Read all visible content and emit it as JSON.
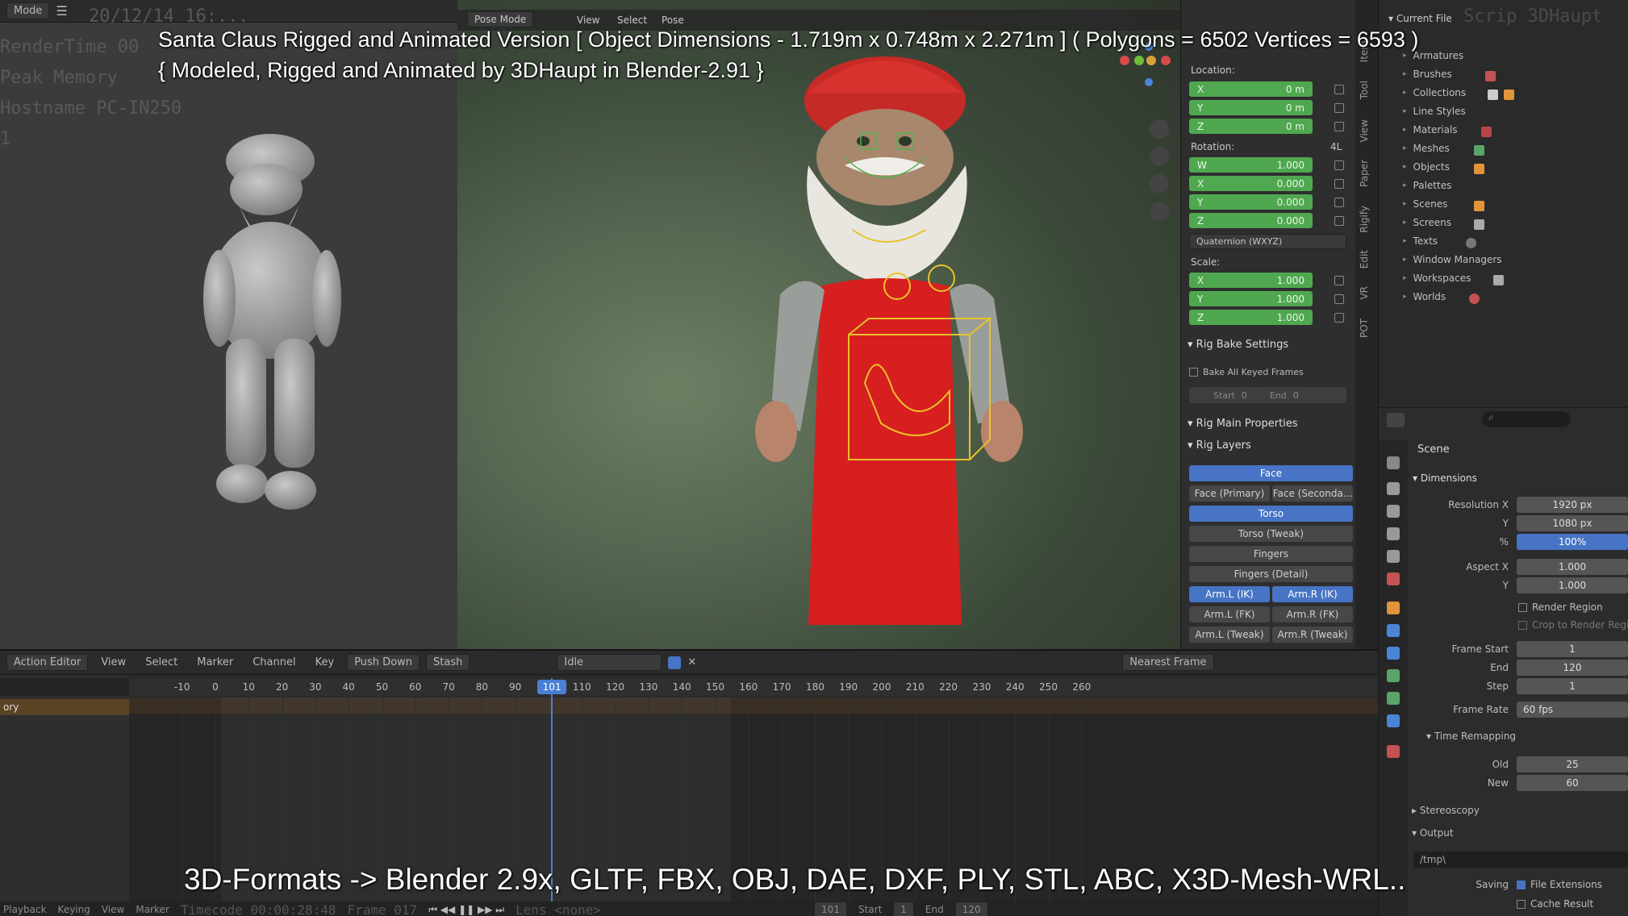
{
  "overlay": {
    "title_line1": "Santa Claus Rigged and Animated Version [ Object Dimensions -  1.719m x 0.748m x 2.271m ] ( Polygons = 6502  Vertices = 6593 )",
    "title_line2": "{ Modeled, Rigged and Animated by 3DHaupt in Blender-2.91 }",
    "formats": "3D-Formats -> Blender 2.9x, GLTF, FBX, OBJ, DAE, DXF, PLY, STL, ABC, X3D-Mesh-WRL.."
  },
  "left_panel": {
    "mode": "Mode",
    "sys_lines": [
      "20/12/14 16:...",
      "RenderTime 00",
      "Peak Memory",
      "Hostname PC-IN250",
      "1"
    ]
  },
  "viewport": {
    "mode": "Pose Mode",
    "menu": [
      "View",
      "Select",
      "Pose"
    ]
  },
  "npanel": {
    "location_label": "Location:",
    "location": [
      {
        "axis": "X",
        "value": "0 m"
      },
      {
        "axis": "Y",
        "value": "0 m"
      },
      {
        "axis": "Z",
        "value": "0 m"
      }
    ],
    "rotation_label": "Rotation:",
    "rotation_mode_short": "4L",
    "rotation": [
      {
        "axis": "W",
        "value": "1.000"
      },
      {
        "axis": "X",
        "value": "0.000"
      },
      {
        "axis": "Y",
        "value": "0.000"
      },
      {
        "axis": "Z",
        "value": "0.000"
      }
    ],
    "rotation_mode": "Quaternion (WXYZ)",
    "scale_label": "Scale:",
    "scale": [
      {
        "axis": "X",
        "value": "1.000"
      },
      {
        "axis": "Y",
        "value": "1.000"
      },
      {
        "axis": "Z",
        "value": "1.000"
      }
    ],
    "bake_header": "Rig Bake Settings",
    "bake_all": "Bake All Keyed Frames",
    "bake_start": "Start",
    "bake_start_val": "0",
    "bake_end": "End",
    "bake_end_val": "0",
    "main_props": "Rig Main Properties",
    "rig_layers": "Rig Layers",
    "layers": {
      "face": "Face",
      "face_primary": "Face (Primary)",
      "face_secondary": "Face (Seconda...",
      "torso": "Torso",
      "torso_tweak": "Torso (Tweak)",
      "fingers": "Fingers",
      "fingers_detail": "Fingers (Detail)",
      "arm_l_ik": "Arm.L (IK)",
      "arm_r_ik": "Arm.R (IK)",
      "arm_l_fk": "Arm.L (FK)",
      "arm_r_fk": "Arm.R (FK)",
      "arm_l_tweak": "Arm.L (Tweak)",
      "arm_r_tweak": "Arm.R (Tweak)"
    }
  },
  "side_tabs": [
    "Item",
    "Tool",
    "View",
    "Paper",
    "Rigify",
    "Edit",
    "VR",
    "POT"
  ],
  "outliner": {
    "header": "Current File",
    "bg_text": "Scrip 3DHaupt",
    "items": [
      "Armatures",
      "Brushes",
      "Collections",
      "Line Styles",
      "Materials",
      "Meshes",
      "Objects",
      "Palettes",
      "Scenes",
      "Screens",
      "Texts",
      "Window Managers",
      "Workspaces",
      "Worlds"
    ]
  },
  "properties": {
    "scene": "Scene",
    "dimensions": "Dimensions",
    "res_x_label": "Resolution X",
    "res_x": "1920 px",
    "res_y_label": "Y",
    "res_y": "1080 px",
    "res_pct_label": "%",
    "res_pct": "100%",
    "aspect_x_label": "Aspect X",
    "aspect_x": "1.000",
    "aspect_y_label": "Y",
    "aspect_y": "1.000",
    "render_region": "Render Region",
    "crop": "Crop to Render Region",
    "frame_start_label": "Frame Start",
    "frame_start": "1",
    "end_label": "End",
    "end": "120",
    "step_label": "Step",
    "step": "1",
    "frame_rate_label": "Frame Rate",
    "frame_rate": "60 fps",
    "time_remap": "Time Remapping",
    "old_label": "Old",
    "old": "25",
    "new_label": "New",
    "new": "60",
    "stereoscopy": "Stereoscopy",
    "output": "Output",
    "output_path": "/tmp\\",
    "saving": "Saving",
    "file_ext": "File Extensions",
    "cache_result": "Cache Result"
  },
  "action_editor": {
    "editor": "Action Editor",
    "menus": [
      "View",
      "Select",
      "Marker",
      "Channel",
      "Key"
    ],
    "push_down": "Push Down",
    "stash": "Stash",
    "action_name": "Idle",
    "snap": "Nearest Frame",
    "channel_name": "ory",
    "current_frame": "101",
    "ticks": [
      "-10",
      "0",
      "10",
      "20",
      "30",
      "40",
      "50",
      "60",
      "70",
      "80",
      "90",
      "101",
      "110",
      "120",
      "130",
      "140",
      "150",
      "160",
      "170",
      "180",
      "190",
      "200",
      "210",
      "220",
      "230",
      "240",
      "250",
      "260"
    ]
  },
  "footer": {
    "playback": "Playback",
    "keying": "Keying",
    "view": "View",
    "marker": "Marker",
    "timecode": "Timecode 00:00:28:48",
    "frame": "Frame 017",
    "lens": "Lens <none>",
    "cur": "101",
    "start_label": "Start",
    "start": "1",
    "end_label": "End",
    "end": "120"
  }
}
